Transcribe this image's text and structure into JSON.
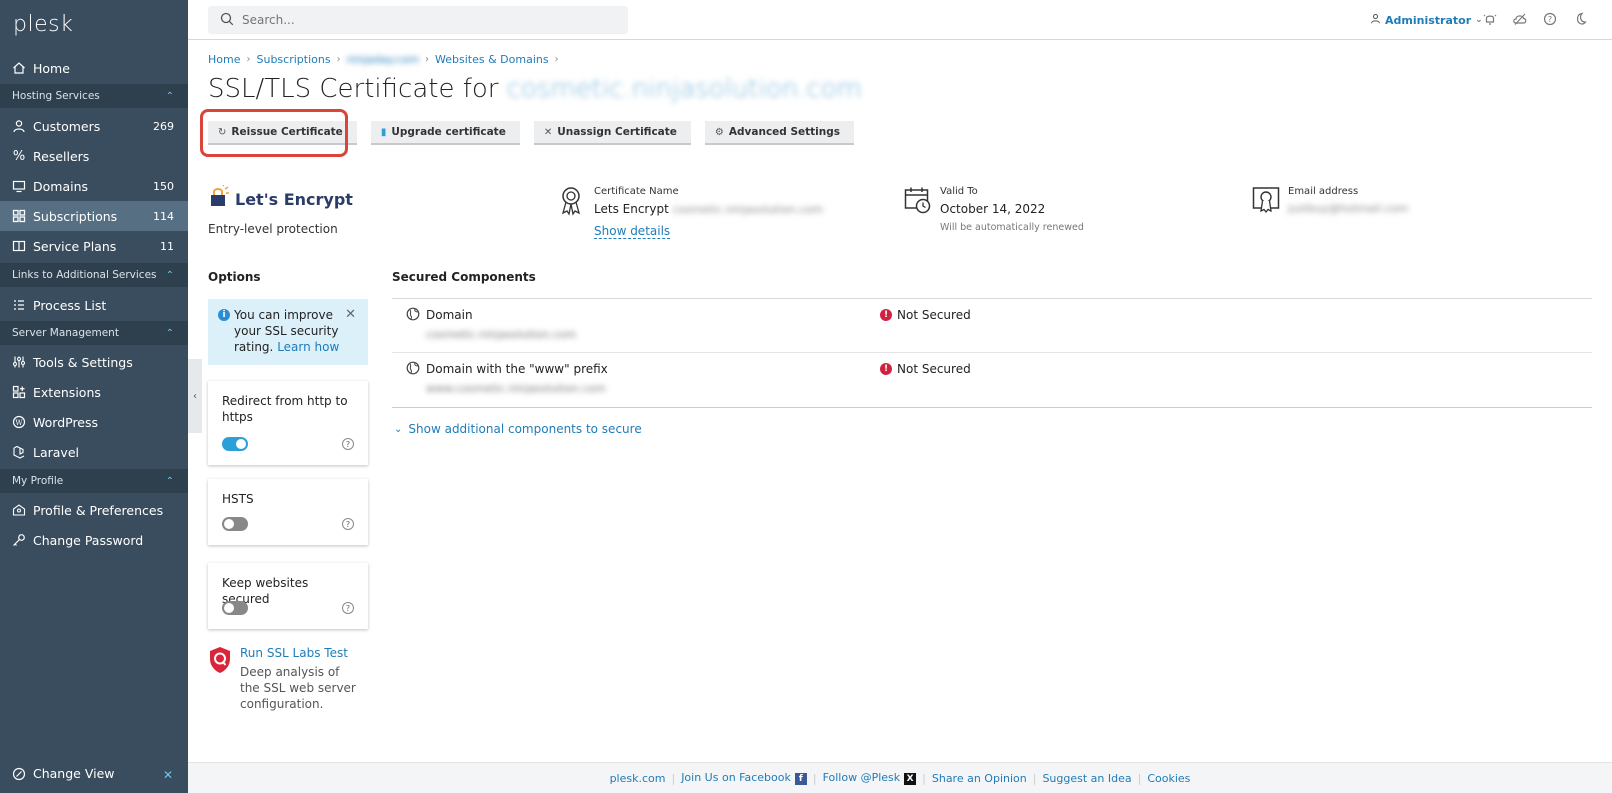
{
  "app": {
    "logo": "plesk"
  },
  "sidebar": {
    "items": [
      {
        "label": "Home"
      },
      {
        "label": "Customers",
        "count": "269"
      },
      {
        "label": "Resellers"
      },
      {
        "label": "Domains",
        "count": "150"
      },
      {
        "label": "Subscriptions",
        "count": "114"
      },
      {
        "label": "Service Plans",
        "count": "11"
      },
      {
        "label": "Process List"
      },
      {
        "label": "Tools & Settings"
      },
      {
        "label": "Extensions"
      },
      {
        "label": "WordPress"
      },
      {
        "label": "Laravel"
      },
      {
        "label": "Profile & Preferences"
      },
      {
        "label": "Change Password"
      }
    ],
    "sections": [
      "Hosting Services",
      "Links to Additional Services",
      "Server Management",
      "My Profile"
    ],
    "change_view": "Change View"
  },
  "topbar": {
    "search_placeholder": "Search...",
    "user": "Administrator"
  },
  "breadcrumb": [
    "Home",
    "Subscriptions",
    "ninjaday.com",
    "Websites & Domains"
  ],
  "page": {
    "title": "SSL/TLS Certificate for",
    "title_domain": "cosmetic.ninjasolution.com"
  },
  "toolbar": {
    "reissue": "Reissue Certificate",
    "upgrade": "Upgrade certificate",
    "unassign": "Unassign Certificate",
    "advanced": "Advanced Settings"
  },
  "certificate": {
    "provider": "Let's Encrypt",
    "provider_sub": "Entry-level protection",
    "name_label": "Certificate Name",
    "name_value": "Lets Encrypt",
    "name_blurred": "cosmetic.ninjasolution.com",
    "show_details": "Show details",
    "valid_label": "Valid To",
    "valid_value": "October 14, 2022",
    "valid_note": "Will be automatically renewed",
    "email_label": "Email address",
    "email_blurred": "justbuy@hotmail.com"
  },
  "options": {
    "title": "Options",
    "info_text": "You can improve your SSL security rating.",
    "info_link": "Learn how",
    "redirect": "Redirect from http to https",
    "hsts": "HSTS",
    "keep_secured": "Keep websites secured",
    "ssl_labs_link": "Run SSL Labs Test",
    "ssl_labs_desc": "Deep analysis of the SSL web server configuration."
  },
  "toggles": {
    "redirect": true,
    "hsts": false,
    "keep_secured": false
  },
  "secured": {
    "title": "Secured Components",
    "rows": [
      {
        "name": "Domain",
        "sub": "cosmetic.ninjasolution.com",
        "status": "Not Secured"
      },
      {
        "name": "Domain with the \"www\" prefix",
        "sub": "www.cosmetic.ninjasolution.com",
        "status": "Not Secured"
      }
    ],
    "show_more": "Show additional components to secure"
  },
  "footer": {
    "links": [
      "plesk.com",
      "Join Us on Facebook",
      "Follow @Plesk",
      "Share an Opinion",
      "Suggest an Idea",
      "Cookies"
    ]
  },
  "colors": {
    "sidebar": "#3a4d5e",
    "accent": "#1f7cb8",
    "error": "#d0213f",
    "highlight": "#d9453a"
  }
}
